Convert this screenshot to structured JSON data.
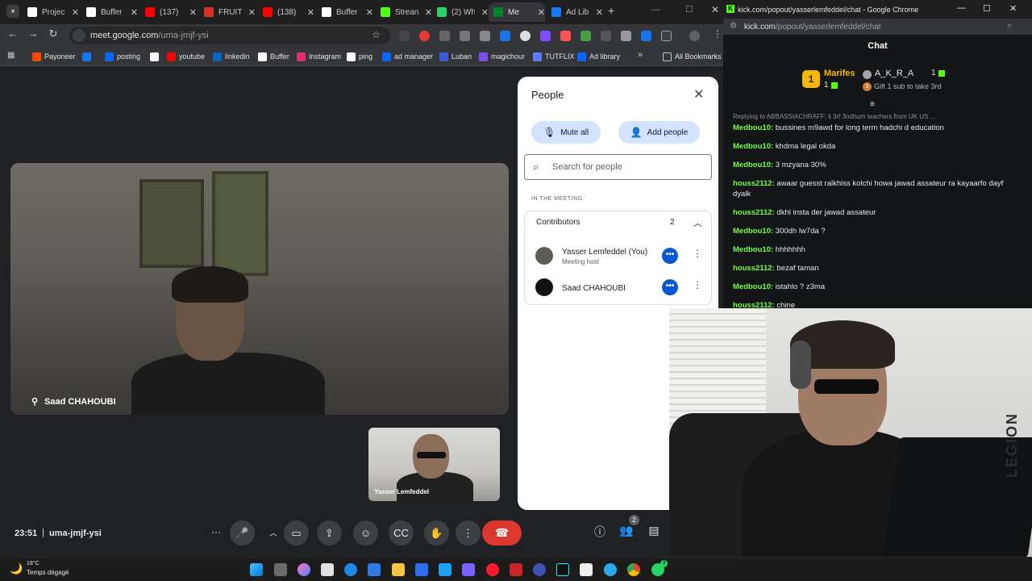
{
  "browser_left": {
    "tabs": [
      {
        "label": "Projec",
        "color": "#ffffff",
        "active": false
      },
      {
        "label": "Buffer",
        "color": "#ffffff",
        "active": false
      },
      {
        "label": "(137)",
        "color": "#ff0000",
        "active": false
      },
      {
        "label": "FRUIT",
        "color": "#d93025",
        "active": false
      },
      {
        "label": "(138)",
        "color": "#ff0000",
        "active": false
      },
      {
        "label": "Buffer",
        "color": "#ffffff",
        "active": false
      },
      {
        "label": "Strean",
        "color": "#53fc18",
        "active": false
      },
      {
        "label": "(2) Wh",
        "color": "#25d366",
        "active": false
      },
      {
        "label": "Me",
        "color": "#00832d",
        "active": true
      },
      {
        "label": "Ad Lib",
        "color": "#1877f2",
        "active": false
      }
    ],
    "url_host": "meet.google.com",
    "url_path": "/uma-jmjf-ysi",
    "bookmarks": [
      {
        "label": "Payoneer",
        "color": "#ff4800"
      },
      {
        "label": "",
        "color": "#1877f2"
      },
      {
        "label": "posting",
        "color": "#0866ff"
      },
      {
        "label": "",
        "color": "#ffffff"
      },
      {
        "label": "youtube",
        "color": "#ff0000"
      },
      {
        "label": "linkedin",
        "color": "#0a66c2"
      },
      {
        "label": "Buffer",
        "color": "#ffffff"
      },
      {
        "label": "Instagram",
        "color": "#e1306c"
      },
      {
        "label": "ping",
        "color": "#ffffff"
      },
      {
        "label": "ad manager",
        "color": "#0866ff"
      },
      {
        "label": "Luban",
        "color": "#3b5bdb"
      },
      {
        "label": "magichour",
        "color": "#7950f2"
      },
      {
        "label": "TUTFLIX",
        "color": "#5c7cfa"
      },
      {
        "label": "Ad library",
        "color": "#0866ff"
      }
    ],
    "all_bookmarks": "All Bookmarks"
  },
  "meet": {
    "main_participant": "Saad CHAHOUBI",
    "self_participant": "Yasser Lemfeddel",
    "clock": "23:51",
    "separator": "|",
    "meeting_code": "uma-jmjf-ysi",
    "people_badge": "2",
    "end_call_color": "#dc362e"
  },
  "people_panel": {
    "title": "People",
    "mute_all": "Mute all",
    "add_people": "Add people",
    "search_placeholder": "Search for people",
    "section": "IN THE MEETING",
    "group_label": "Contributors",
    "group_count": "2",
    "participants": [
      {
        "name": "Yasser Lemfeddel (You)",
        "role": "Meeting host"
      },
      {
        "name": "Saad CHAHOUBI",
        "role": ""
      }
    ]
  },
  "kick_window": {
    "window_title": "kick.com/popout/yasserlemfeddel/chat - Google Chrome",
    "url_host": "kick.com",
    "url_path": "/popout/yasserlemfeddel/chat",
    "chat_title": "Chat",
    "leader_name": "Marifes",
    "leader_rank": "1",
    "leader_subs": "1",
    "second_name": "A_K_R_A",
    "second_subs": "1",
    "gift_text": "Gift 1 sub to take 3rd",
    "gift_rank": "3",
    "replying": "Replying to ABBASSIACHRAFF: li 3rf 3ndhum teachers from UK US ...",
    "messages": [
      {
        "user": "Medbou10",
        "text": "bussines m9awd for long term hadchi d education"
      },
      {
        "user": "Medbou10",
        "text": "khdma legal okda"
      },
      {
        "user": "Medbou10",
        "text": "3 mzyana 30%"
      },
      {
        "user": "houss2112",
        "text": "awaar guesst ralkhiss kolchi howa jawad assateur ra kayaarfo dayf dyalk"
      },
      {
        "user": "houss2112",
        "text": "dkhl insta der jawad assateur"
      },
      {
        "user": "Medbou10",
        "text": "300dh lw7da ?"
      },
      {
        "user": "Medbou10",
        "text": "hhhhhhh"
      },
      {
        "user": "houss2112",
        "text": "bezaf taman"
      },
      {
        "user": "Medbou10",
        "text": "istahlo ? z3ma"
      },
      {
        "user": "houss2112",
        "text": "chine"
      }
    ],
    "accent": "#53fc18"
  },
  "cam": {
    "brand": "LEGION"
  },
  "taskbar": {
    "temperature": "18°C",
    "weather": "Temps dégagé",
    "badge_count": "3"
  }
}
